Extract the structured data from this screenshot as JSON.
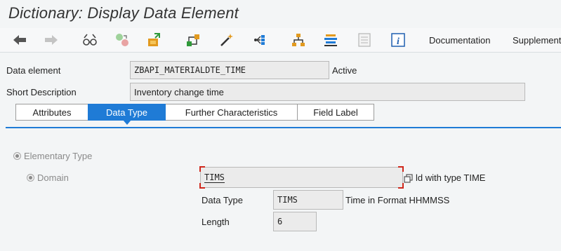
{
  "window": {
    "title": "Dictionary: Display Data Element"
  },
  "toolbar": {
    "icons": [
      "back-arrow-icon",
      "forward-arrow-icon",
      "glasses-icon",
      "switch-objects-icon",
      "activate-icon",
      "where-used-icon",
      "magic-wand-icon",
      "display-object-list-icon",
      "hierarchy-icon",
      "navigation-stack-icon",
      "document-icon",
      "info-icon"
    ],
    "documentation_label": "Documentation",
    "supplement_label": "Supplement"
  },
  "header": {
    "data_element_label": "Data element",
    "data_element_value": "ZBAPI_MATERIALDTE_TIME",
    "status": "Active",
    "short_description_label": "Short Description",
    "short_description_value": "Inventory change time"
  },
  "tabs": [
    {
      "label": "Attributes",
      "active": false
    },
    {
      "label": "Data Type",
      "active": true
    },
    {
      "label": "Further Characteristics",
      "active": false
    },
    {
      "label": "Field Label",
      "active": false
    }
  ],
  "data_type": {
    "elementary_type_label": "Elementary Type",
    "domain_label": "Domain",
    "domain_value": "TIMS",
    "domain_suffix": "ld with type TIME",
    "data_type_label": "Data Type",
    "data_type_value": "TIMS",
    "data_type_desc": "Time in Format HHMMSS",
    "length_label": "Length",
    "length_value": "6"
  },
  "colors": {
    "accent": "#1f7bd6",
    "focus_corner": "#d0281c",
    "background": "#f3f5f6",
    "field_bg": "#ebebeb"
  }
}
